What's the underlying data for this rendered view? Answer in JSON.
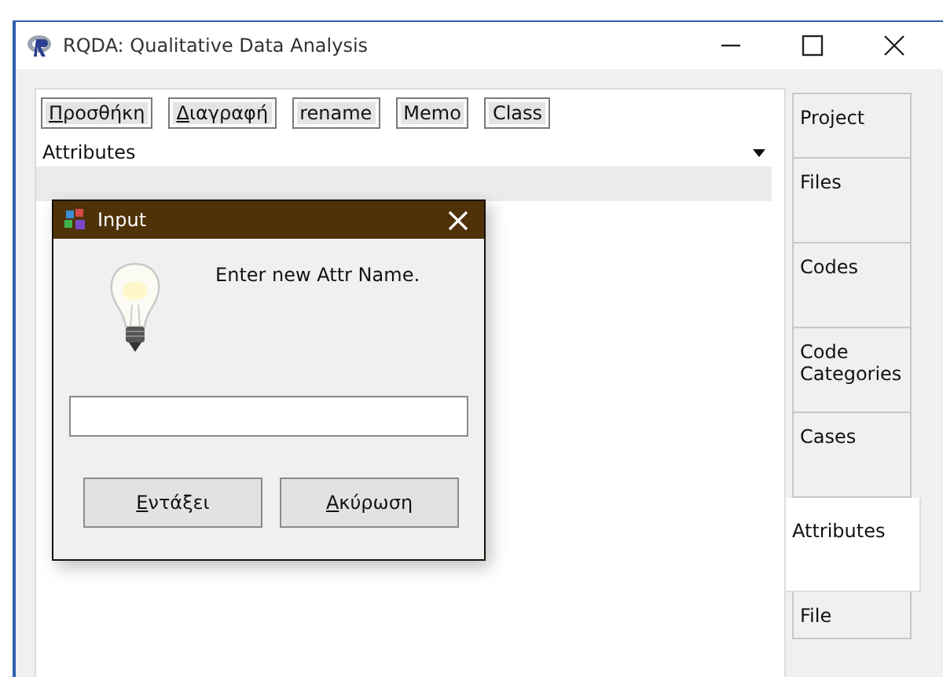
{
  "window": {
    "title": "RQDA: Qualitative Data Analysis"
  },
  "toolbar": [
    {
      "label": "Προσθήκη",
      "underline_first": true
    },
    {
      "label": "Διαγραφή",
      "underline_first": true
    },
    {
      "label": "rename",
      "underline_first": false
    },
    {
      "label": "Memo",
      "underline_first": false
    },
    {
      "label": "Class",
      "underline_first": false
    }
  ],
  "list": {
    "header": "Attributes"
  },
  "tabs": [
    {
      "label": "Project",
      "selected": false
    },
    {
      "label": "Files",
      "selected": false
    },
    {
      "label": "Codes",
      "selected": false
    },
    {
      "label": "Code Categories",
      "selected": false
    },
    {
      "label": "Cases",
      "selected": false
    },
    {
      "label": "Attributes",
      "selected": true
    },
    {
      "label": "File",
      "selected": false
    }
  ],
  "dialog": {
    "title": "Input",
    "message": "Enter new Attr Name.",
    "buttons": [
      {
        "label": "Εντάξει",
        "underline_first": true
      },
      {
        "label": "Ακύρωση",
        "underline_first": true
      }
    ]
  }
}
